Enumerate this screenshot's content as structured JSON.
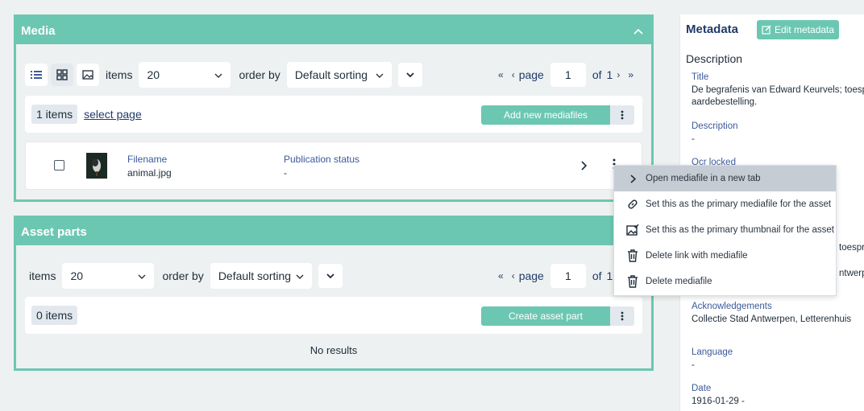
{
  "media_panel": {
    "title": "Media",
    "items_label": "items",
    "items_value": "20",
    "order_label": "order by",
    "order_value": "Default sorting",
    "page_label": "page",
    "page_value": "1",
    "of_label": "of",
    "of_value": "1",
    "count": "1 items",
    "select_page": "select page",
    "add_button": "Add new mediafiles",
    "row": {
      "filename_label": "Filename",
      "filename_value": "animal.jpg",
      "status_label": "Publication status",
      "status_value": "-"
    }
  },
  "asset_parts_panel": {
    "title": "Asset parts",
    "items_label": "items",
    "items_value": "20",
    "order_label": "order by",
    "order_value": "Default sorting",
    "page_label": "page",
    "page_value": "1",
    "of_label": "of",
    "of_value": "1",
    "count": "0 items",
    "create_button": "Create asset part",
    "empty": "No results"
  },
  "context_menu": {
    "items": [
      {
        "label": "Open mediafile in a new tab",
        "icon": "chevron-right-icon"
      },
      {
        "label": "Set this as the primary mediafile for the asset",
        "icon": "link-icon"
      },
      {
        "label": "Set this as the primary thumbnail for the asset",
        "icon": "image-check-icon"
      },
      {
        "label": "Delete link with mediafile",
        "icon": "trash-icon"
      },
      {
        "label": "Delete mediafile",
        "icon": "trash-icon"
      }
    ]
  },
  "metadata": {
    "title": "Metadata",
    "edit_button": "Edit metadata",
    "section": "Description",
    "fields": {
      "title_label": "Title",
      "title_line1": "De begrafenis van Edward Keurvels; toespra",
      "title_line2": "aardebestelling.",
      "description_label": "Description",
      "description_value": "-",
      "ocr_label": "Ocr locked",
      "hidden1_tail": "toespra",
      "hidden2_tail": "ntwerpe",
      "ack_label": "Acknowledgements",
      "ack_value": "Collectie Stad Antwerpen, Letterenhuis",
      "lang_label": "Language",
      "lang_value": "-",
      "date_label": "Date",
      "date_value": "1916-01-29 -"
    }
  },
  "colors": {
    "accent": "#6cc7b2",
    "link": "#1f3b6a",
    "menu_highlight": "#c5ccd4"
  }
}
